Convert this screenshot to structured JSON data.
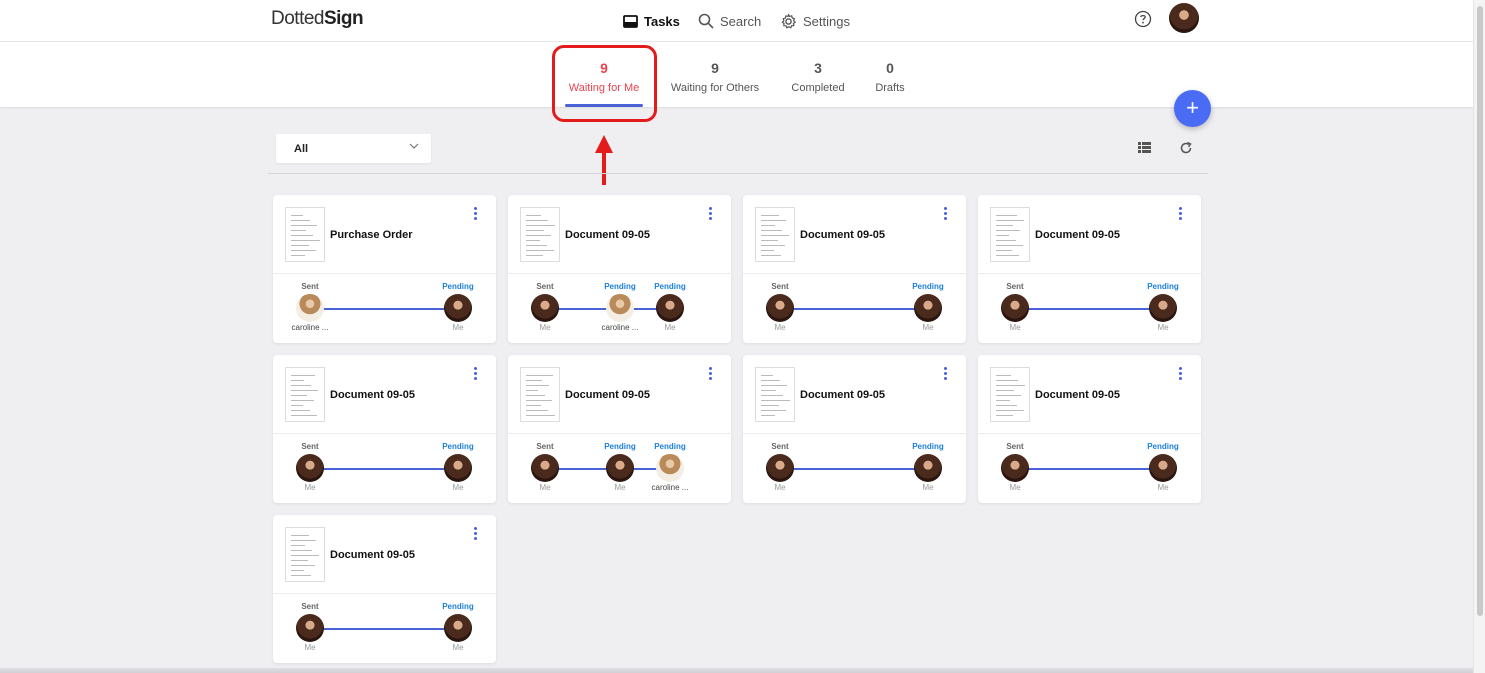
{
  "app": {
    "logo_light": "Dotted",
    "logo_bold": "Sign"
  },
  "nav": {
    "tasks": "Tasks",
    "search": "Search",
    "settings": "Settings"
  },
  "tabs": [
    {
      "count": "9",
      "label": "Waiting for Me",
      "active": true
    },
    {
      "count": "9",
      "label": "Waiting for Others"
    },
    {
      "count": "3",
      "label": "Completed"
    },
    {
      "count": "0",
      "label": "Drafts"
    }
  ],
  "filter": {
    "value": "All"
  },
  "fab": {
    "label": "+"
  },
  "colors": {
    "accent": "#4a63d8",
    "active_tab": "#e8434e",
    "pending": "#1a7fd9",
    "annotation": "#e31b1b",
    "fab": "#4a6cf4"
  },
  "cards": [
    {
      "title": "Purchase Order",
      "steps": [
        {
          "status": "Sent",
          "name": "caroline ..."
        },
        {
          "status": "Pending",
          "name": "Me"
        }
      ]
    },
    {
      "title": "Document 09-05",
      "steps": [
        {
          "status": "Sent",
          "name": "Me"
        },
        {
          "status": "Pending",
          "name": "caroline ..."
        },
        {
          "status": "Pending",
          "name": "Me"
        }
      ]
    },
    {
      "title": "Document 09-05",
      "steps": [
        {
          "status": "Sent",
          "name": "Me"
        },
        {
          "status": "Pending",
          "name": "Me"
        }
      ]
    },
    {
      "title": "Document 09-05",
      "steps": [
        {
          "status": "Sent",
          "name": "Me"
        },
        {
          "status": "Pending",
          "name": "Me"
        }
      ]
    },
    {
      "title": "Document 09-05",
      "steps": [
        {
          "status": "Sent",
          "name": "Me"
        },
        {
          "status": "Pending",
          "name": "Me"
        }
      ]
    },
    {
      "title": "Document 09-05",
      "steps": [
        {
          "status": "Sent",
          "name": "Me"
        },
        {
          "status": "Pending",
          "name": "Me"
        },
        {
          "status": "Pending",
          "name": "caroline ..."
        }
      ]
    },
    {
      "title": "Document 09-05",
      "steps": [
        {
          "status": "Sent",
          "name": "Me"
        },
        {
          "status": "Pending",
          "name": "Me"
        }
      ]
    },
    {
      "title": "Document 09-05",
      "steps": [
        {
          "status": "Sent",
          "name": "Me"
        },
        {
          "status": "Pending",
          "name": "Me"
        }
      ]
    },
    {
      "title": "Document 09-05",
      "steps": [
        {
          "status": "Sent",
          "name": "Me"
        },
        {
          "status": "Pending",
          "name": "Me"
        }
      ]
    }
  ]
}
